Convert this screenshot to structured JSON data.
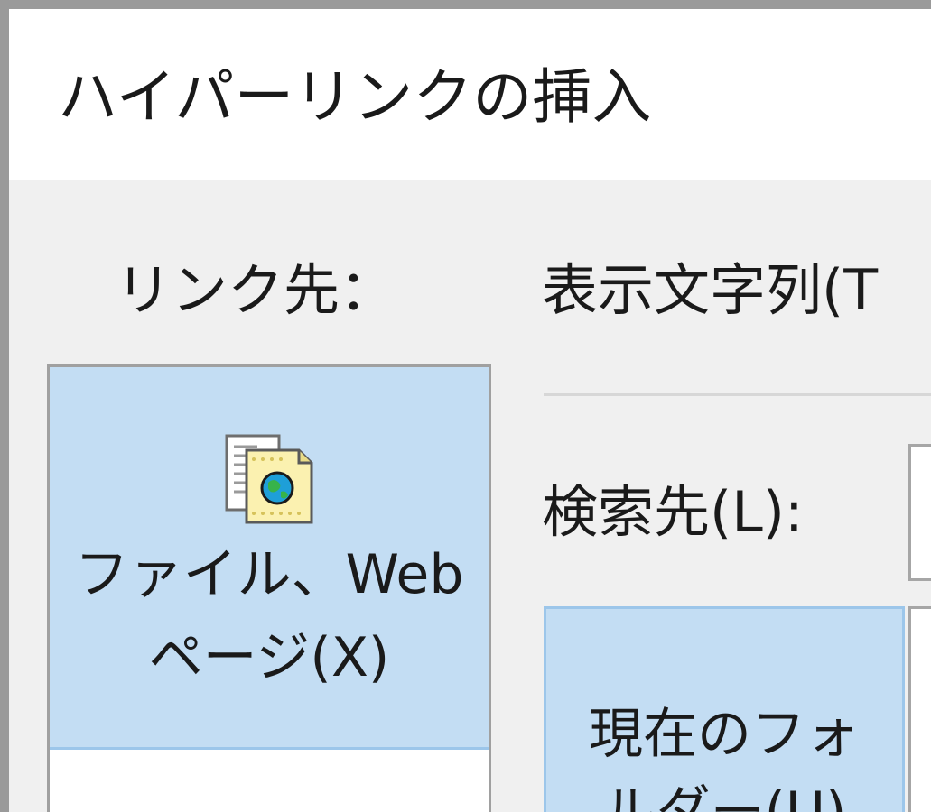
{
  "window": {
    "title": "ハイパーリンクの挿入"
  },
  "link_to": {
    "label": "リンク先：",
    "items": [
      {
        "label": "ファイル、Web\nページ(X)",
        "icon": "existing-file-web-page-icon",
        "selected": true
      }
    ]
  },
  "display_text": {
    "label": "表示文字列(T"
  },
  "look_in": {
    "label": "検索先(L):",
    "value": ""
  },
  "browse": {
    "current_folder_label": "現在のフォ\nルダー(U)"
  },
  "colors": {
    "selected_bg": "#c3ddf3",
    "selected_border": "#9cc6ea",
    "dialog_bg": "#f0f0f0",
    "title_bg": "#ffffff"
  }
}
